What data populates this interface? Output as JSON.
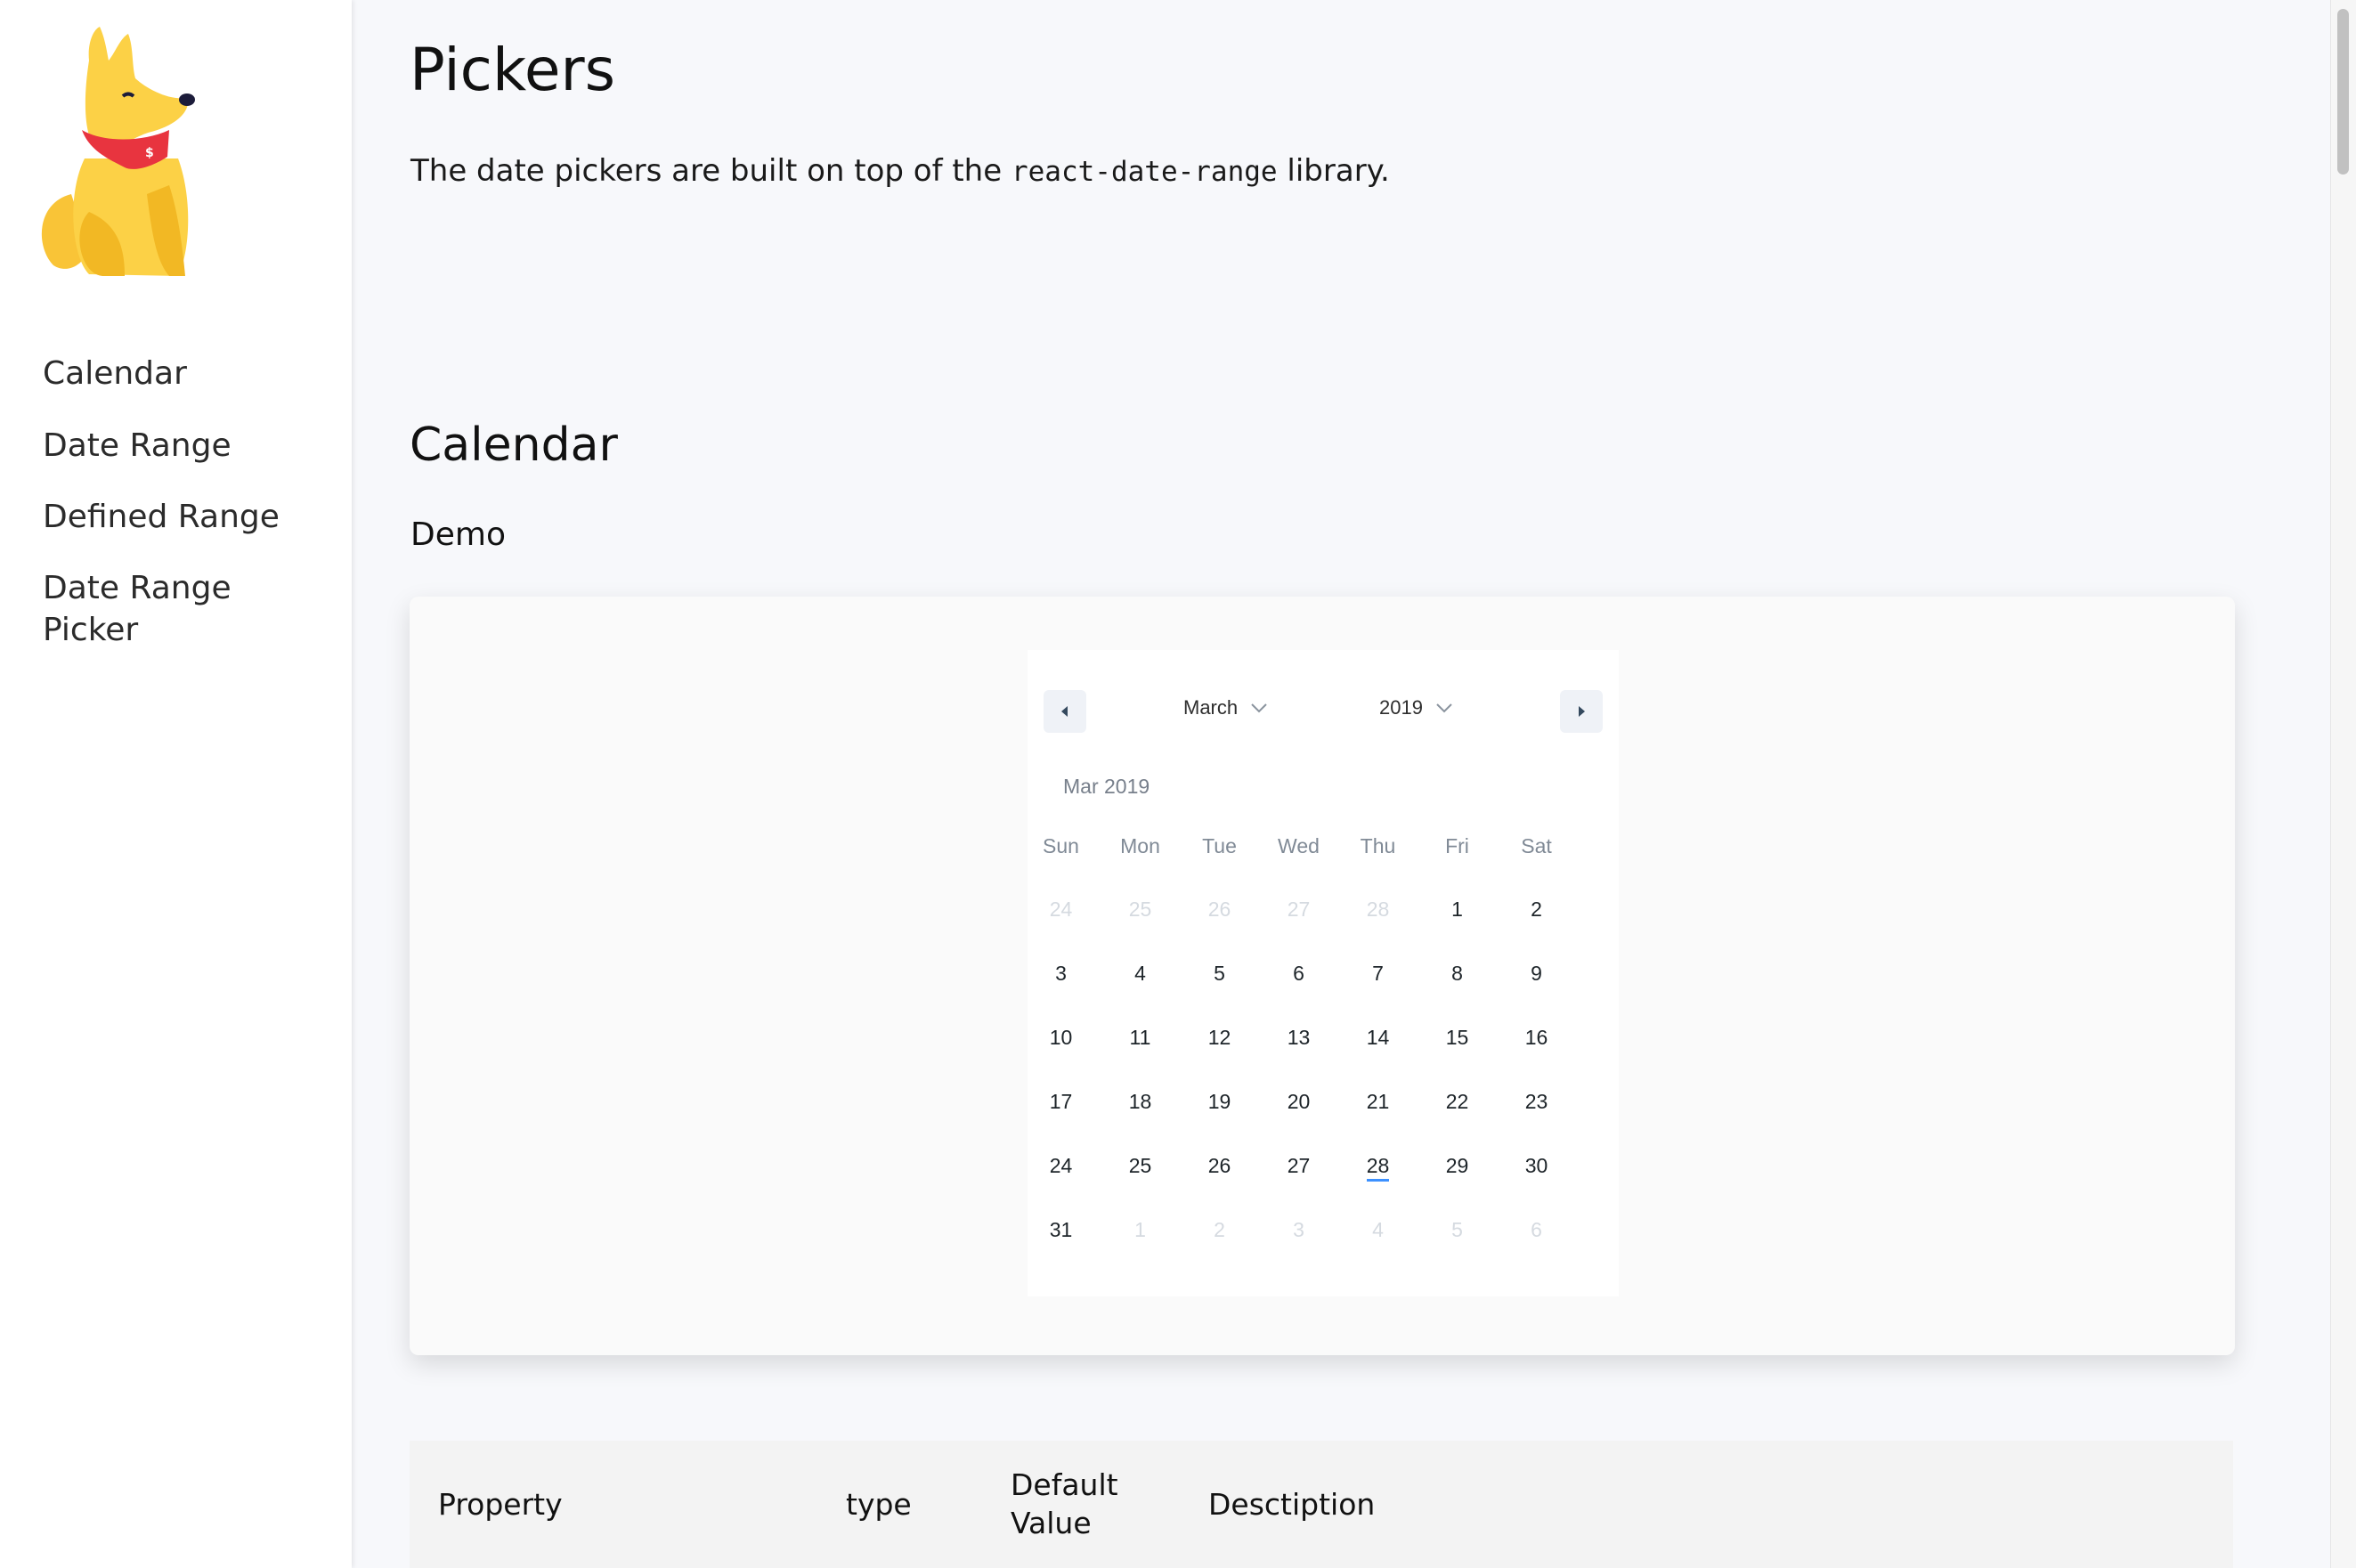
{
  "sidebar": {
    "logo": "dog-mascot-logo",
    "items": [
      {
        "label": "Calendar"
      },
      {
        "label": "Date Range"
      },
      {
        "label": "Defined Range"
      },
      {
        "label": "Date Range Picker"
      }
    ]
  },
  "main": {
    "title": "Pickers",
    "intro": {
      "before": "The date pickers are built on top of the",
      "code": "react-date-range",
      "after": "library."
    },
    "section_title": "Calendar",
    "demo_heading": "Demo"
  },
  "calendar": {
    "prev_icon": "caret-left-icon",
    "next_icon": "caret-right-icon",
    "month_select": "March",
    "year_select": "2019",
    "month_label": "Mar 2019",
    "weekdays": [
      "Sun",
      "Mon",
      "Tue",
      "Wed",
      "Thu",
      "Fri",
      "Sat"
    ],
    "days": [
      {
        "d": "24",
        "muted": true
      },
      {
        "d": "25",
        "muted": true
      },
      {
        "d": "26",
        "muted": true
      },
      {
        "d": "27",
        "muted": true
      },
      {
        "d": "28",
        "muted": true
      },
      {
        "d": "1"
      },
      {
        "d": "2"
      },
      {
        "d": "3"
      },
      {
        "d": "4"
      },
      {
        "d": "5"
      },
      {
        "d": "6"
      },
      {
        "d": "7"
      },
      {
        "d": "8"
      },
      {
        "d": "9"
      },
      {
        "d": "10"
      },
      {
        "d": "11"
      },
      {
        "d": "12"
      },
      {
        "d": "13"
      },
      {
        "d": "14"
      },
      {
        "d": "15"
      },
      {
        "d": "16"
      },
      {
        "d": "17"
      },
      {
        "d": "18"
      },
      {
        "d": "19"
      },
      {
        "d": "20"
      },
      {
        "d": "21"
      },
      {
        "d": "22"
      },
      {
        "d": "23"
      },
      {
        "d": "24"
      },
      {
        "d": "25"
      },
      {
        "d": "26"
      },
      {
        "d": "27"
      },
      {
        "d": "28",
        "today": true
      },
      {
        "d": "29"
      },
      {
        "d": "30"
      },
      {
        "d": "31"
      },
      {
        "d": "1",
        "muted": true
      },
      {
        "d": "2",
        "muted": true
      },
      {
        "d": "3",
        "muted": true
      },
      {
        "d": "4",
        "muted": true
      },
      {
        "d": "5",
        "muted": true
      },
      {
        "d": "6",
        "muted": true
      }
    ],
    "today_color": "#3d91ff"
  },
  "table": {
    "headers": [
      "Property",
      "type",
      "Default Value",
      "Desctiption"
    ]
  }
}
